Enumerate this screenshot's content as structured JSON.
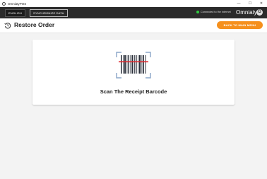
{
  "window": {
    "title": "OmniatyPOS",
    "controls": {
      "minimize": "—",
      "maximize": "☐",
      "close": "✕"
    }
  },
  "topbar": {
    "language_button": "ENGLISH",
    "sync_button": "SYNCHRONIZE DATA",
    "connection_status": "Connected to the internet",
    "brand": "Omniaty",
    "brand_icon": "G"
  },
  "header": {
    "title": "Restore Order",
    "icon": "restore-icon",
    "back_button": "BACK TO MAIN MENU"
  },
  "main": {
    "icon": "barcode-scan-icon",
    "scan_label": "Scan The Receipt Barcode"
  },
  "colors": {
    "accent": "#f5901d",
    "topbar": "#2b2b2b",
    "status_ok": "#2ecc40",
    "scan_line": "#e0262b",
    "corner_brackets": "#8aa6c8"
  }
}
